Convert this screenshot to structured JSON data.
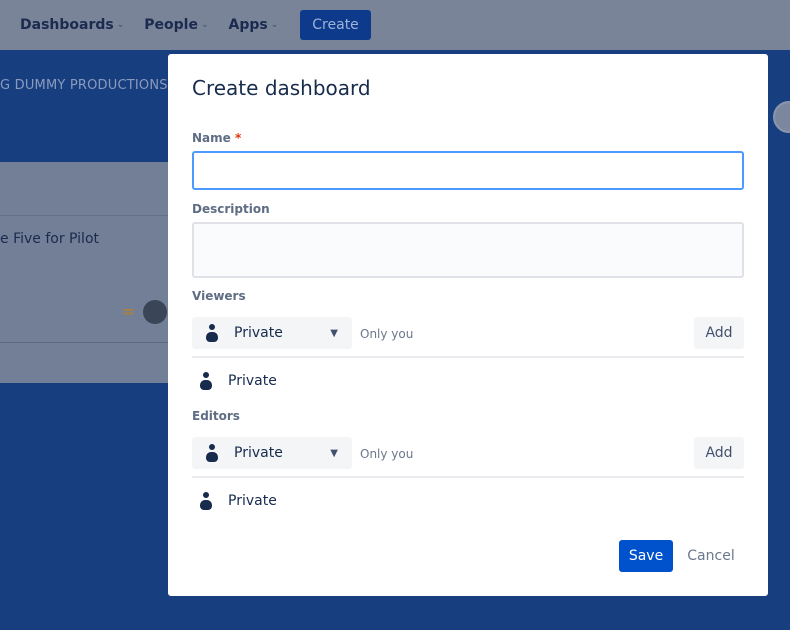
{
  "nav": {
    "items": [
      {
        "label": "Dashboards"
      },
      {
        "label": "People"
      },
      {
        "label": "Apps"
      }
    ],
    "create_label": "Create"
  },
  "background": {
    "company": "G DUMMY PRODUCTIONS",
    "card_title": "e Five for Pilot"
  },
  "modal": {
    "title": "Create dashboard",
    "name_label": "Name",
    "required_mark": "*",
    "name_value": "",
    "description_label": "Description",
    "description_value": "",
    "viewers": {
      "label": "Viewers",
      "select": "Private",
      "hint": "Only you",
      "add": "Add",
      "entry": "Private"
    },
    "editors": {
      "label": "Editors",
      "select": "Private",
      "hint": "Only you",
      "add": "Add",
      "entry": "Private"
    },
    "save": "Save",
    "cancel": "Cancel"
  }
}
